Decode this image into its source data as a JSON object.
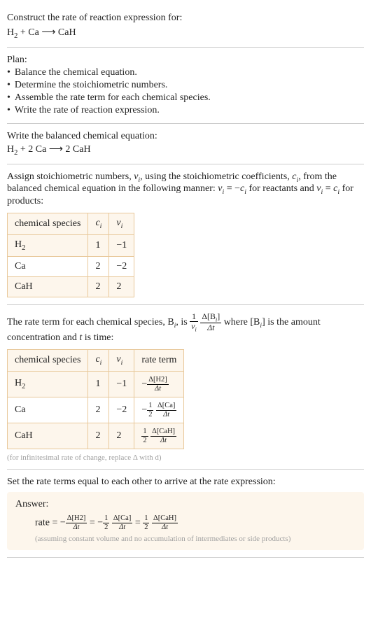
{
  "prompt_line1": "Construct the rate of reaction expression for:",
  "eq_reactants": "H",
  "eq_sub2": "2",
  "eq_plus": " + Ca ",
  "eq_arrow": "⟶",
  "eq_products": " CaH",
  "plan_title": "Plan:",
  "plan_items": [
    "Balance the chemical equation.",
    "Determine the stoichiometric numbers.",
    "Assemble the rate term for each chemical species.",
    "Write the rate of reaction expression."
  ],
  "balanced_title": "Write the balanced chemical equation:",
  "balanced_plus": " + 2 Ca ",
  "balanced_prod": " 2 CaH",
  "stoich_text_a": "Assign stoichiometric numbers, ",
  "stoich_nu": "ν",
  "stoich_i": "i",
  "stoich_text_b": ", using the stoichiometric coefficients, ",
  "stoich_c": "c",
  "stoich_text_c": ", from the balanced chemical equation in the following manner: ",
  "stoich_text_d": " = −",
  "stoich_text_e": " for reactants and ",
  "stoich_text_f": " = ",
  "stoich_text_g": " for products:",
  "table1_headers": [
    "chemical species",
    "cᵢ",
    "νᵢ"
  ],
  "table1_rows": [
    {
      "species_prefix": "H",
      "species_sub": "2",
      "c": "1",
      "nu": "−1"
    },
    {
      "species_prefix": "Ca",
      "species_sub": "",
      "c": "2",
      "nu": "−2"
    },
    {
      "species_prefix": "CaH",
      "species_sub": "",
      "c": "2",
      "nu": "2"
    }
  ],
  "rateterm_text_a": "The rate term for each chemical species, B",
  "rateterm_text_b": ", is ",
  "rateterm_text_c": " where [B",
  "rateterm_text_d": "] is the amount concentration and ",
  "rateterm_t": "t",
  "rateterm_text_e": " is time:",
  "frac1_num": "1",
  "frac1_den_nu": "ν",
  "frac2_num": "Δ[B",
  "frac2_num_close": "]",
  "frac2_den": "Δt",
  "table2_headers": [
    "chemical species",
    "cᵢ",
    "νᵢ",
    "rate term"
  ],
  "table2_rows": [
    {
      "species_prefix": "H",
      "species_sub": "2",
      "c": "1",
      "nu": "−1",
      "rate_neg": "−",
      "rate_coef_num": "",
      "rate_coef_den": "",
      "rate_num": "Δ[H2]",
      "rate_den": "Δt"
    },
    {
      "species_prefix": "Ca",
      "species_sub": "",
      "c": "2",
      "nu": "−2",
      "rate_neg": "−",
      "rate_coef_num": "1",
      "rate_coef_den": "2",
      "rate_num": "Δ[Ca]",
      "rate_den": "Δt"
    },
    {
      "species_prefix": "CaH",
      "species_sub": "",
      "c": "2",
      "nu": "2",
      "rate_neg": "",
      "rate_coef_num": "1",
      "rate_coef_den": "2",
      "rate_num": "Δ[CaH]",
      "rate_den": "Δt"
    }
  ],
  "infinitesimal_note": "(for infinitesimal rate of change, replace Δ with d)",
  "final_title": "Set the rate terms equal to each other to arrive at the rate expression:",
  "answer_label": "Answer:",
  "rate_label": "rate = −",
  "eq_h2_num": "Δ[H2]",
  "eq_h2_den": "Δt",
  "eq_mid1": " = −",
  "eq_half_num": "1",
  "eq_half_den": "2",
  "eq_ca_num": "Δ[Ca]",
  "eq_ca_den": "Δt",
  "eq_mid2": " = ",
  "eq_cah_num": "Δ[CaH]",
  "eq_cah_den": "Δt",
  "assumption_note": "(assuming constant volume and no accumulation of intermediates or side products)"
}
